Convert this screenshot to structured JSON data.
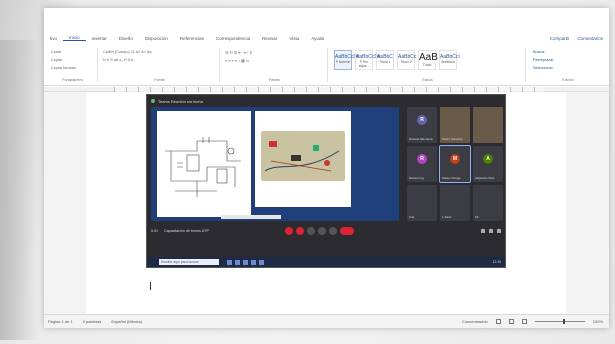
{
  "menu": {
    "tabs": [
      "tivo",
      "Inicio",
      "Insertar",
      "Diseño",
      "Disposición",
      "Referencias",
      "Correspondencia",
      "Revisar",
      "Vista",
      "Ayuda"
    ],
    "active_tab": "Inicio",
    "share_label": "Compartir",
    "comments_label": "Comentarios"
  },
  "ribbon": {
    "clipboard": {
      "cut": "Cortar",
      "copy": "Copiar",
      "format_painter": "Copiar formato",
      "group_label": "Portapapeles"
    },
    "font": {
      "font_name": "Calibri (Cuerpo)",
      "font_size": "11",
      "group_label": "Fuente"
    },
    "paragraph": {
      "group_label": "Párrafo"
    },
    "styles": {
      "items": [
        {
          "preview": "AaBbCcDc",
          "name": "¶ Normal"
        },
        {
          "preview": "AaBbCcDc",
          "name": "¶ Sin espa..."
        },
        {
          "preview": "AaBbC",
          "name": "Título 1"
        },
        {
          "preview": "AaBbCc",
          "name": "Título 2"
        },
        {
          "preview": "AaB",
          "name": "Título"
        },
        {
          "preview": "AaBbCcI",
          "name": "Subtítulo"
        }
      ],
      "group_label": "Estilos"
    },
    "editing": {
      "find": "Buscar",
      "replace": "Reemplazar",
      "select": "Seleccionar",
      "group_label": "Edición"
    }
  },
  "meeting": {
    "window_title": "Teams Reunión sin fecha",
    "footer_title": "Capacitación de tornos UTP",
    "time": "0:41",
    "taskbar_search": "Escribe aquí para buscar",
    "taskbar_time": "12:45",
    "participants": [
      {
        "initial": "R",
        "name": "Ricardo Mendoza",
        "color": "#6264a7"
      },
      {
        "initial": "",
        "name": "Pedro Sanchez",
        "color": "#7a6a5a",
        "video": true
      },
      {
        "initial": "",
        "name": "",
        "color": "#7a6a5a",
        "video": true
      },
      {
        "initial": "R",
        "name": "Ramon Ing",
        "color": "#b146c2"
      },
      {
        "initial": "M",
        "name": "Mateo Ortega",
        "color": "#c43e1c",
        "active": true
      },
      {
        "initial": "A",
        "name": "Alejandro Ruiz",
        "color": "#498205"
      },
      {
        "initial": "",
        "name": "Ana",
        "color": "#555"
      },
      {
        "initial": "",
        "name": "L.Sanz",
        "color": "#555"
      },
      {
        "initial": "",
        "name": "Kit",
        "color": "#555"
      }
    ]
  },
  "status": {
    "page": "Página 1 de 1",
    "words": "0 palabras",
    "language": "Español (México)",
    "focus": "Concentración",
    "zoom": "100%"
  }
}
